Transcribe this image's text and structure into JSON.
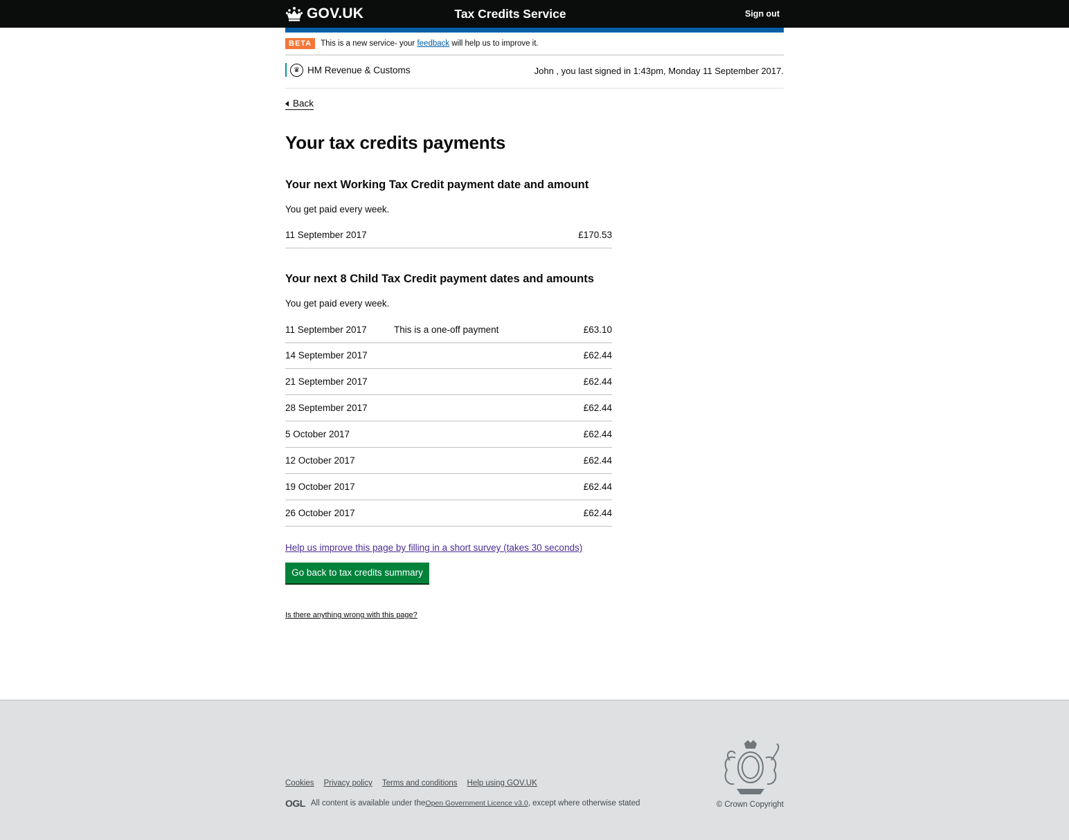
{
  "header": {
    "logo_text": "GOV.UK",
    "service_name": "Tax Credits Service",
    "sign_out": "Sign out"
  },
  "beta": {
    "tag": "BETA",
    "text_before": "This is a new service- your ",
    "link": "feedback",
    "text_after": " will help us to improve it."
  },
  "org": {
    "name": "HM Revenue & Customs",
    "last_signed_in": "John , you last signed in 1:43pm, Monday 11 September 2017."
  },
  "back": "Back",
  "page_title": "Your tax credits payments",
  "working_tax_credit": {
    "heading": "Your next Working Tax Credit payment date and amount",
    "frequency": "You get paid every week.",
    "payments": [
      {
        "date": "11 September 2017",
        "note": "",
        "amount": "£170.53"
      }
    ]
  },
  "child_tax_credit": {
    "heading": "Your next 8 Child Tax Credit payment dates and amounts",
    "frequency": "You get paid every week.",
    "payments": [
      {
        "date": "11 September 2017",
        "note": "This is a one-off payment",
        "amount": "£63.10"
      },
      {
        "date": "14 September 2017",
        "note": "",
        "amount": "£62.44"
      },
      {
        "date": "21 September 2017",
        "note": "",
        "amount": "£62.44"
      },
      {
        "date": "28 September 2017",
        "note": "",
        "amount": "£62.44"
      },
      {
        "date": "5 October 2017",
        "note": "",
        "amount": "£62.44"
      },
      {
        "date": "12 October 2017",
        "note": "",
        "amount": "£62.44"
      },
      {
        "date": "19 October 2017",
        "note": "",
        "amount": "£62.44"
      },
      {
        "date": "26 October 2017",
        "note": "",
        "amount": "£62.44"
      }
    ]
  },
  "survey_link": "Help us improve this page by filling in a short survey (takes 30 seconds)",
  "primary_button": "Go back to tax credits summary",
  "report_link": "Is there anything wrong with this page?",
  "footer": {
    "links": [
      "Cookies",
      "Privacy policy",
      "Terms and conditions",
      "Help using GOV.UK"
    ],
    "ogl": "OGL",
    "licence_before": "All content is available under the ",
    "licence_link": "Open Government Licence v3.0",
    "licence_after": ", except where otherwise stated",
    "copyright": "© Crown Copyright"
  },
  "colors": {
    "header_bg": "#0b0c0c",
    "blue_bar": "#005ea5",
    "beta_tag": "#f47738",
    "button": "#00823b",
    "visited_link": "#4c2c92",
    "footer_bg": "#dee0e2"
  }
}
